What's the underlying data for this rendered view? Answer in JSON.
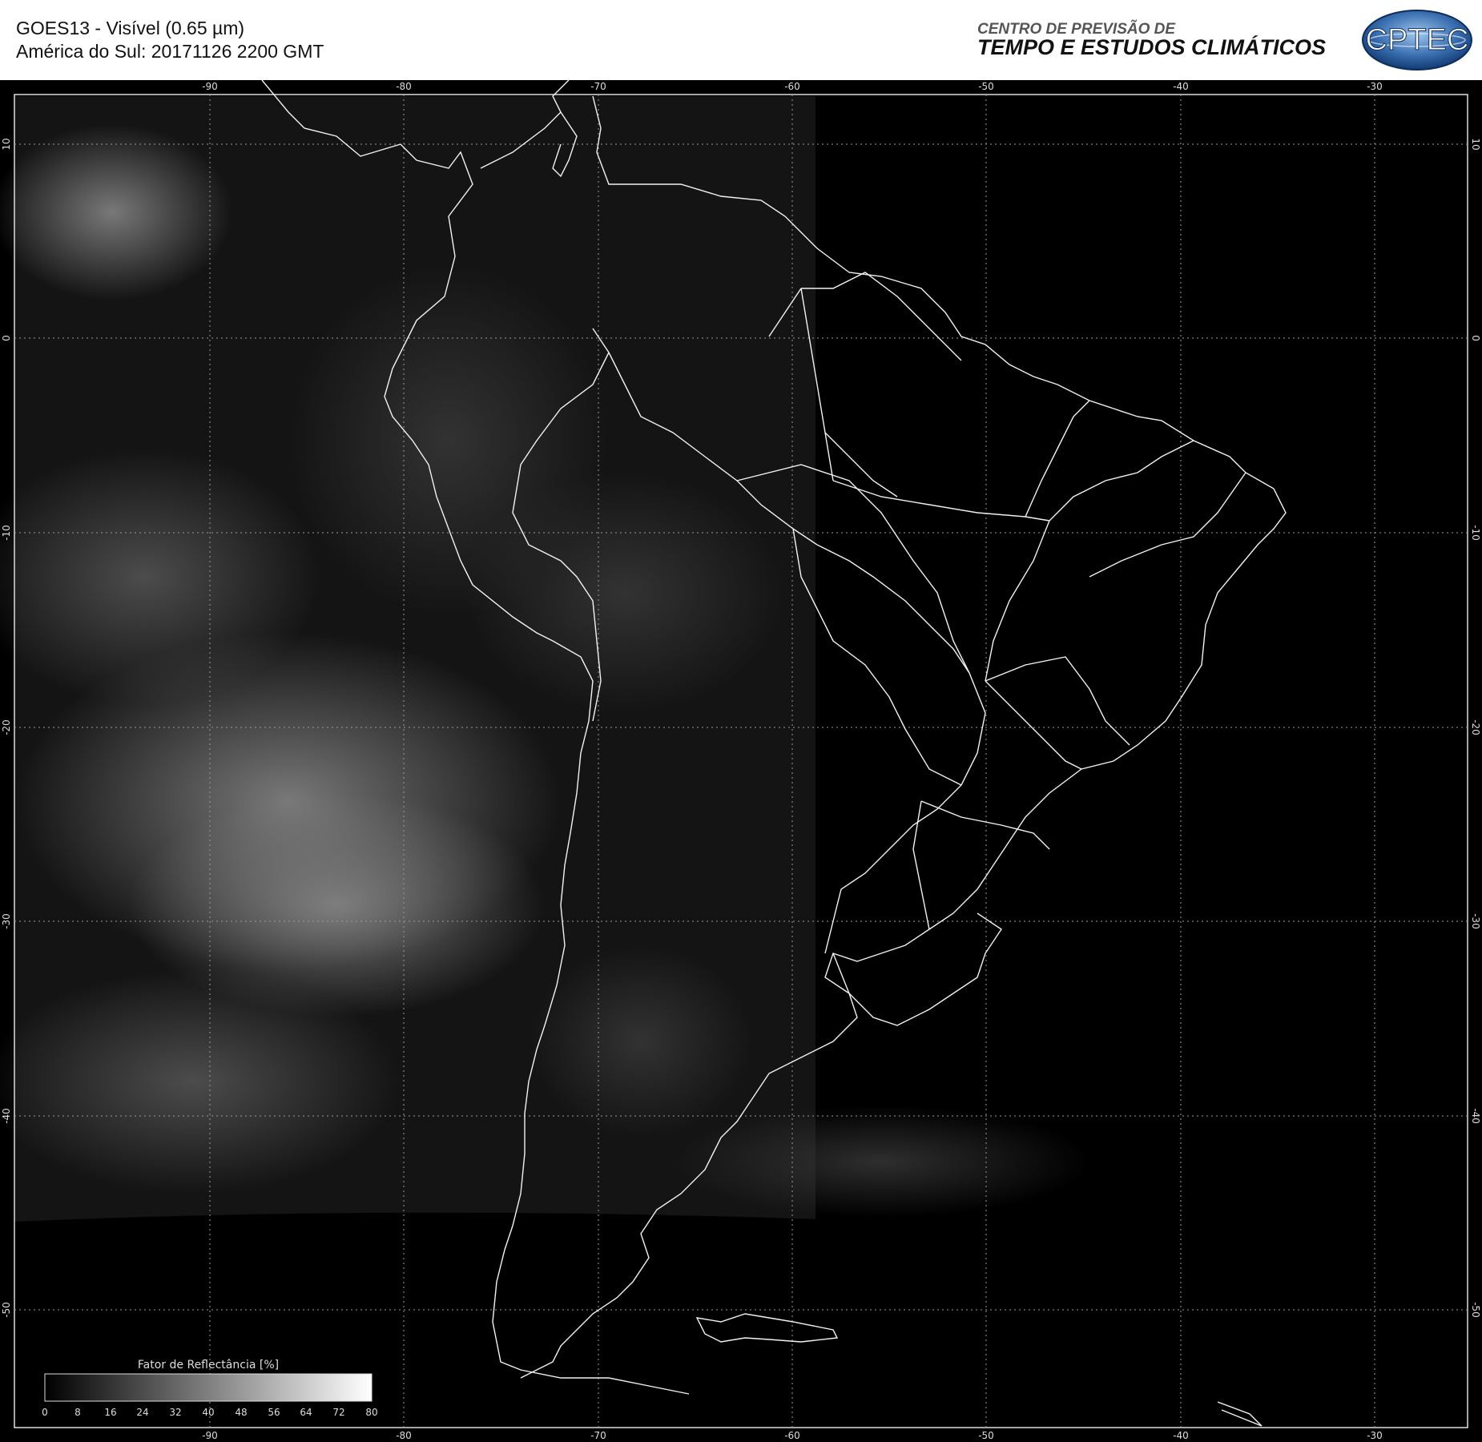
{
  "header": {
    "title_line1": "GOES13 - Visível (0.65 µm)",
    "title_line2": "América do Sul: 20171126 2200 GMT",
    "org_line1": "CENTRO DE PREVISÃO DE",
    "org_line2": "TEMPO E ESTUDOS CLIMÁTICOS",
    "logo_text": "CPTEC"
  },
  "map": {
    "longitude_labels": [
      "-90",
      "-80",
      "-70",
      "-60",
      "-50",
      "-40",
      "-30"
    ],
    "latitude_labels": [
      "10",
      "0",
      "-10",
      "-20",
      "-30",
      "-40",
      "-50"
    ],
    "grid": true,
    "colors": {
      "background": "#000000",
      "coastline": "#ffffff",
      "grid": "#bbbbbb"
    }
  },
  "colorbar": {
    "title": "Fator de Reflectância [%]",
    "ticks": [
      "0",
      "8",
      "16",
      "24",
      "32",
      "40",
      "48",
      "56",
      "64",
      "72",
      "80"
    ],
    "range": [
      0,
      80
    ],
    "colors": [
      "#000000",
      "#ffffff"
    ]
  }
}
